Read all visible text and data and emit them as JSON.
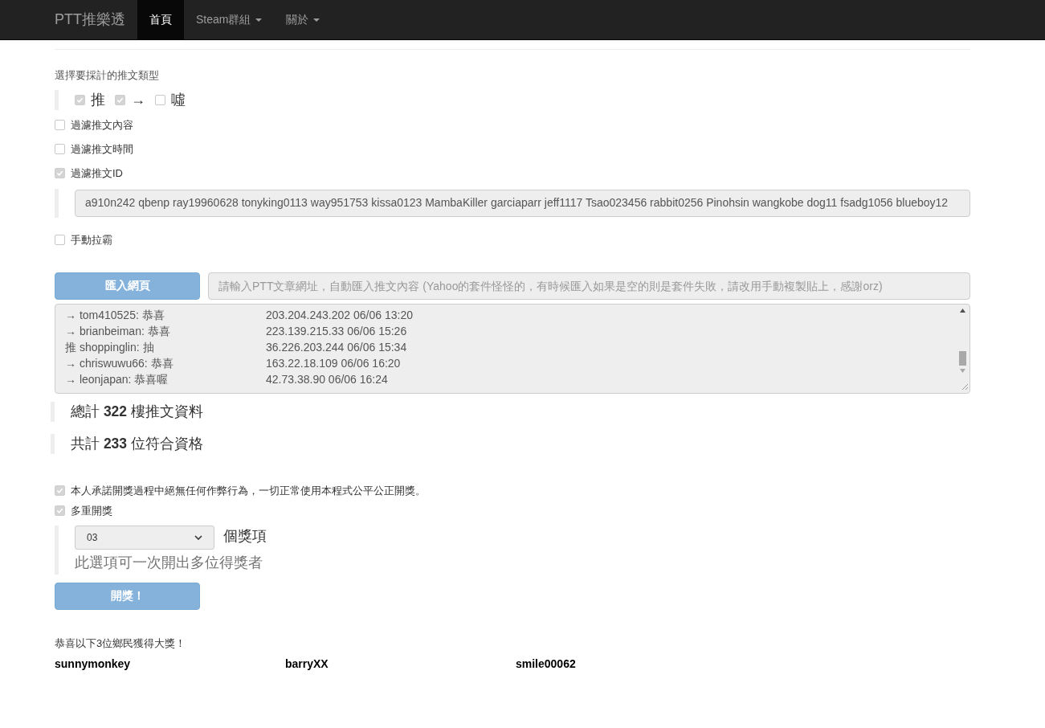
{
  "navbar": {
    "brand": "PTT推樂透",
    "items": [
      {
        "label": "首頁",
        "selected": true,
        "dropdown": false
      },
      {
        "label": "Steam群組",
        "selected": false,
        "dropdown": true
      },
      {
        "label": "關於",
        "selected": false,
        "dropdown": true
      }
    ]
  },
  "push_types": {
    "title": "選擇要採計的推文類型",
    "options": [
      {
        "label": "推",
        "checked": true
      },
      {
        "label": "→",
        "checked": true
      },
      {
        "label": "噓",
        "checked": false
      }
    ]
  },
  "filters": [
    {
      "label": "過濾推文內容",
      "checked": false
    },
    {
      "label": "過濾推文時間",
      "checked": false
    },
    {
      "label": "過濾推文ID",
      "checked": true
    }
  ],
  "id_filter": {
    "value": "a910n242 qbenp ray19960628 tonyking0113 way951753 kissa0123 MambaKiller garciaparr jeff1117 Tsao023456 rabbit0256 Pinohsin wangkobe dog11 fsadg1056 blueboy12"
  },
  "manual": {
    "label": "手動拉霸",
    "checked": false
  },
  "import": {
    "button": "匯入網頁",
    "placeholder": "請輸入PTT文章網址，自動匯入推文內容 (Yahoo的套件怪怪的，有時候匯入如果是空的則是套件失敗，請改用手動複製貼上，感謝orz)"
  },
  "comments": [
    {
      "text": "→ tom410525: 恭喜",
      "meta": "203.204.243.202 06/06 13:20"
    },
    {
      "text": "→ brianbeiman: 恭喜",
      "meta": "223.139.215.33 06/06 15:26"
    },
    {
      "text": "推 shoppinglin: 抽",
      "meta": "36.226.203.244 06/06 15:34"
    },
    {
      "text": "→ chriswuwu66: 恭喜",
      "meta": "163.22.18.109 06/06 16:20"
    },
    {
      "text": "→ leonjapan: 恭喜喔",
      "meta": "42.73.38.90 06/06 16:24"
    }
  ],
  "totals": [
    "總計 **322** 樓推文資料",
    "共計 **233** 位符合資格"
  ],
  "pledge": {
    "label": "本人承諾開獎過程中絕無任何作弊行為，一切正常使用本程式公平公正開獎。",
    "checked": true
  },
  "multi": {
    "label": "多重開獎",
    "checked": true,
    "count": "03",
    "unit": "個獎項",
    "help": "此選項可一次開出多位得獎者"
  },
  "draw_button": "開獎！",
  "result": {
    "title": "恭喜以下3位鄉民獲得大獎！",
    "winners": [
      "sunnymonkey",
      "barryXX",
      "smile00062"
    ]
  }
}
